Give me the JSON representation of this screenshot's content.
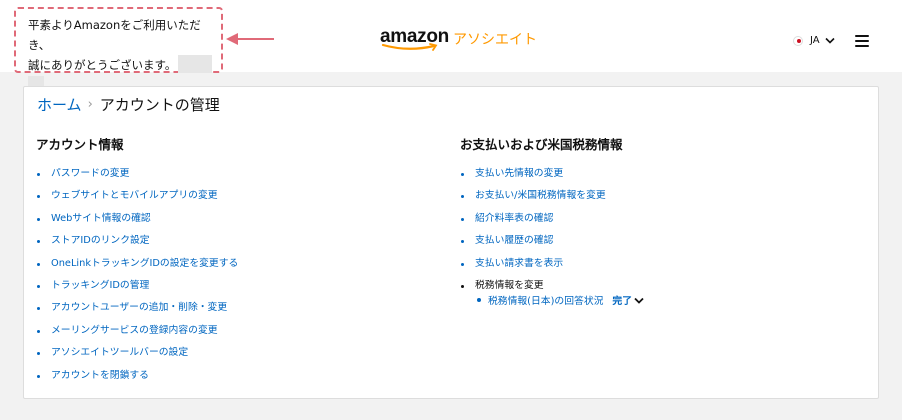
{
  "header": {
    "greeting_line1": "平素よりAmazonをご利用いただき、",
    "greeting_line2": "誠にありがとうございます。",
    "logo_word": "amazon",
    "logo_sub": "アソシエイト",
    "language": "JA",
    "icons": {
      "flag": "japan-flag-icon",
      "lang_chevron": "chevron-down-icon",
      "menu": "hamburger-menu-icon",
      "annotation": "arrow-left-icon"
    },
    "colors": {
      "brand_orange": "#ff9900",
      "annotation_red": "#e06a78",
      "link_blue": "#0066c0"
    }
  },
  "breadcrumb": {
    "home": "ホーム",
    "current": "アカウントの管理"
  },
  "account_section": {
    "title": "アカウント情報",
    "items": [
      "パスワードの変更",
      "ウェブサイトとモバイルアプリの変更",
      "Webサイト情報の確認",
      "ストアIDのリンク設定",
      "OneLinkトラッキングIDの設定を変更する",
      "トラッキングIDの管理",
      "アカウントユーザーの追加・削除・変更",
      "メーリングサービスの登録内容の変更",
      "アソシエイトツールバーの設定",
      "アカウントを閉鎖する"
    ]
  },
  "payment_section": {
    "title": "お支払いおよび米国税務情報",
    "items": [
      "支払い先情報の変更",
      "お支払い/米国税務情報を変更",
      "紹介料率表の確認",
      "支払い履歴の確認",
      "支払い請求書を表示"
    ],
    "tax_heading": "税務情報を変更",
    "tax_sub_link": "税務情報(日本)の回答状況",
    "tax_status": "完了"
  }
}
